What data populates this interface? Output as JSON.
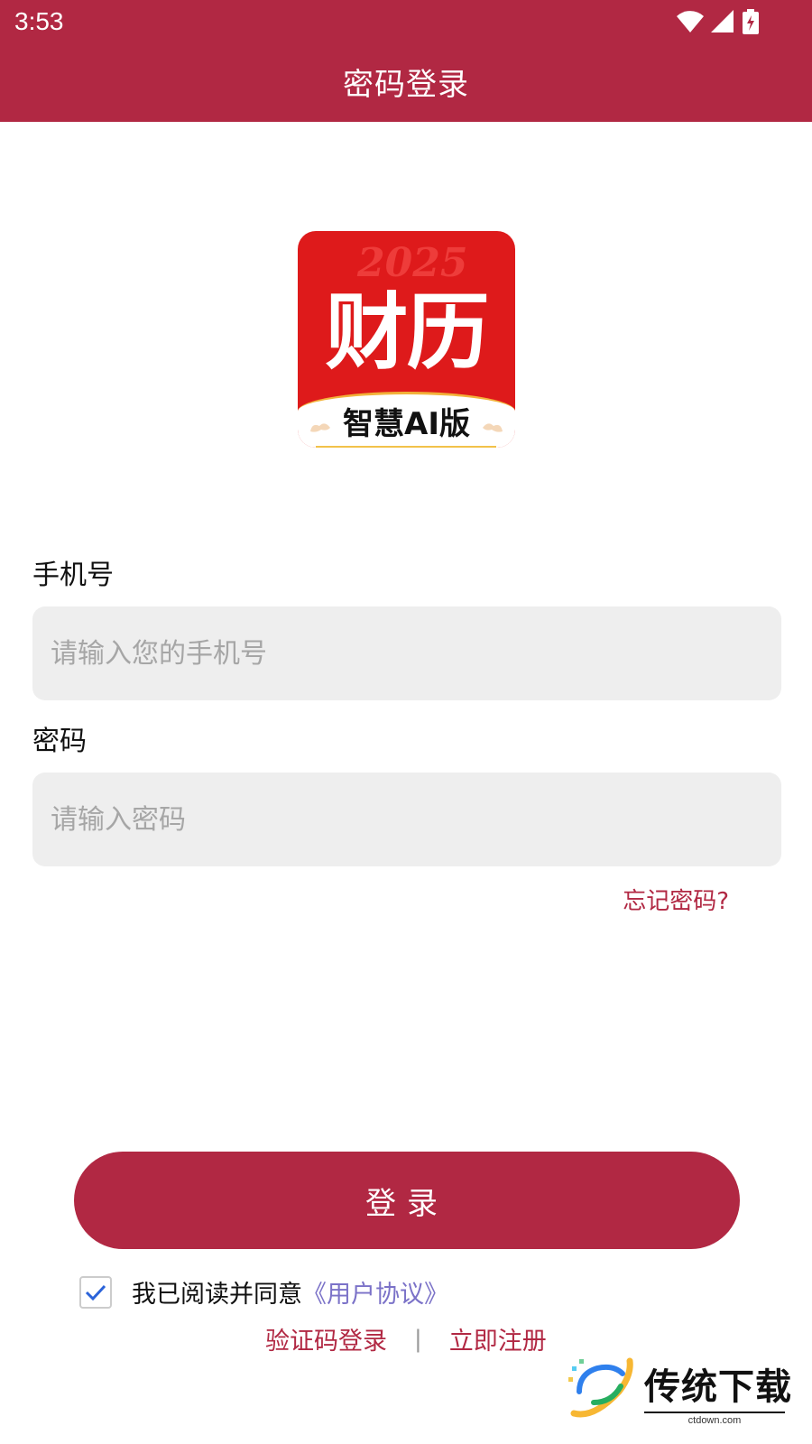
{
  "status_bar": {
    "time": "3:53",
    "icons": [
      "wifi-icon",
      "cellular-signal-icon",
      "battery-charging-icon"
    ]
  },
  "header": {
    "title": "密码登录"
  },
  "logo": {
    "year": "2025",
    "main": "财历",
    "subtitle": "智慧AI版"
  },
  "form": {
    "phone_label": "手机号",
    "phone_placeholder": "请输入您的手机号",
    "phone_value": "",
    "password_label": "密码",
    "password_placeholder": "请输入密码",
    "password_value": "",
    "forgot_label": "忘记密码?"
  },
  "actions": {
    "login_label": "登录"
  },
  "agreement": {
    "checked": true,
    "text": "我已阅读并同意",
    "link_label": "《用户协议》"
  },
  "bottom_links": {
    "sms_login_label": "验证码登录",
    "separator": "|",
    "register_label": "立即注册"
  },
  "watermark": {
    "text": "传统下载",
    "domain": "ctdown.com"
  },
  "colors": {
    "brand": "#B12843",
    "input_bg": "#EEEEEE",
    "link_purple": "#7B72C8",
    "logo_red": "#DE1A1B"
  }
}
